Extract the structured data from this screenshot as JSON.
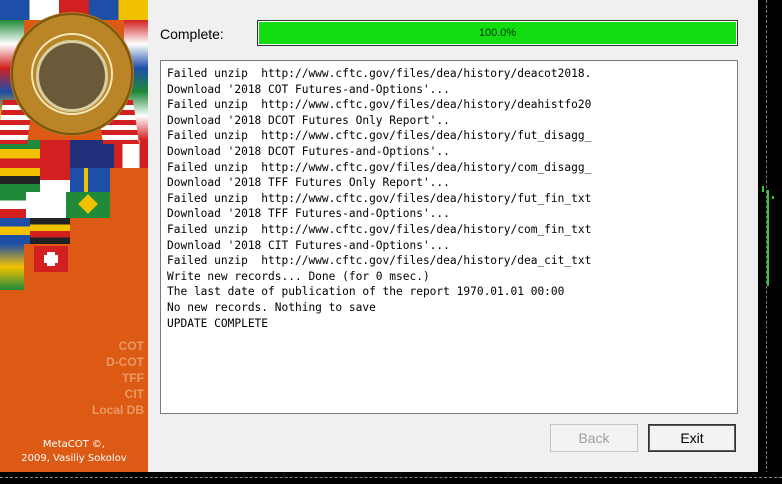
{
  "banner": {
    "seal_text": "COMMODITY FUTURES TRADING COMMISSION",
    "seal_year": "1975",
    "links": [
      "COT",
      "D-COT",
      "TFF",
      "CIT",
      "Local DB"
    ],
    "copyright_line1": "MetaCOT ©,",
    "copyright_line2": "2009, Vasiliy Sokolov"
  },
  "status": {
    "label": "Complete:",
    "progress_text": "100.0%",
    "progress_fraction": 1.0,
    "progress_color": "#11dd11"
  },
  "log": {
    "lines": [
      "Failed unzip  http://www.cftc.gov/files/dea/history/deacot2018.",
      "Download '2018 COT Futures-and-Options'...",
      "Failed unzip  http://www.cftc.gov/files/dea/history/deahistfo20",
      "Download '2018 DCOT Futures Only Report'..",
      "Failed unzip  http://www.cftc.gov/files/dea/history/fut_disagg_",
      "Download '2018 DCOT Futures-and-Options'..",
      "Failed unzip  http://www.cftc.gov/files/dea/history/com_disagg_",
      "Download '2018 TFF Futures Only Report'...",
      "Failed unzip  http://www.cftc.gov/files/dea/history/fut_fin_txt",
      "Download '2018 TFF Futures-and-Options'...",
      "Failed unzip  http://www.cftc.gov/files/dea/history/com_fin_txt",
      "Download '2018 CIT Futures-and-Options'...",
      "Failed unzip  http://www.cftc.gov/files/dea/history/dea_cit_txt",
      "Write new records... Done (for 0 msec.)",
      "The last date of publication of the report 1970.01.01 00:00",
      "No new records. Nothing to save",
      "UPDATE COMPLETE"
    ]
  },
  "buttons": {
    "back": "Back",
    "exit": "Exit"
  },
  "colors": {
    "banner": "#dc5a14",
    "banner_link": "#e89a64",
    "chart_candle": "#2ecc2e"
  }
}
